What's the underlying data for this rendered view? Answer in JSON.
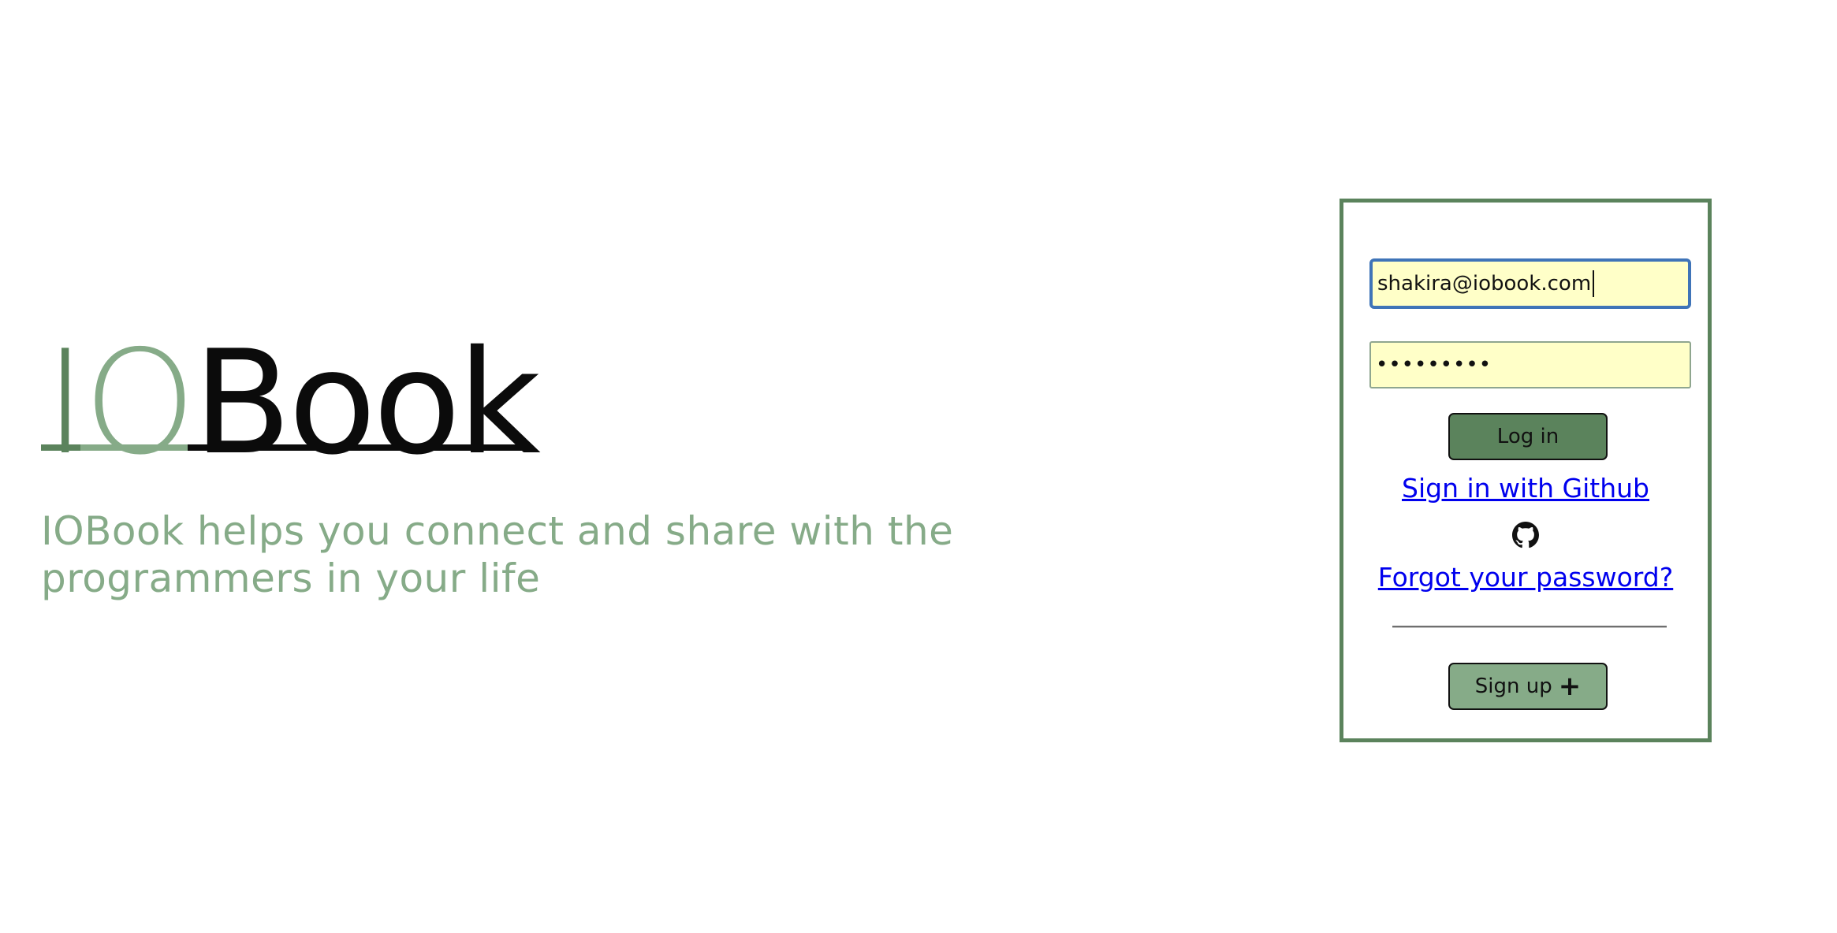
{
  "brand": {
    "logo_i": "I",
    "logo_o": "O",
    "logo_book": "Book",
    "tagline": "IOBook helps you connect and share with the programmers in your life"
  },
  "login": {
    "email_value": "shakira@iobook.com",
    "password_value": "•••••••••",
    "login_label": "Log in",
    "github_link": "Sign in with Github",
    "github_icon": "github-icon",
    "forgot_link": "Forgot your password?",
    "signup_label": "Sign up",
    "signup_icon": "plus-icon"
  },
  "colors": {
    "dark_green": "#5b835c",
    "light_green": "#86ab88",
    "input_bg": "#ffffc8",
    "focus_border": "#3f74b8",
    "link": "#0000ee"
  }
}
